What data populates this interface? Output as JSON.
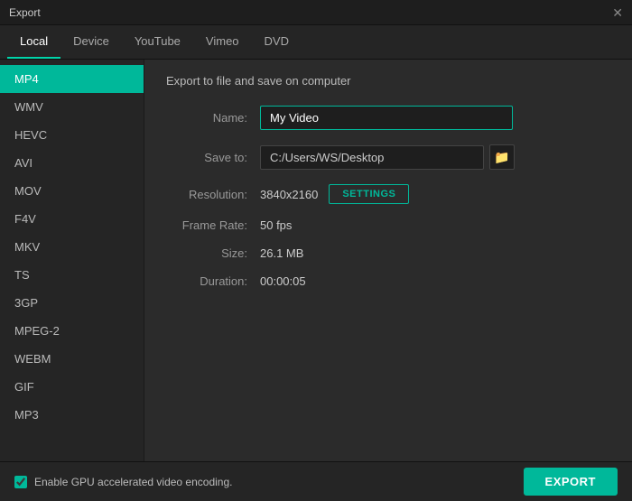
{
  "titleBar": {
    "title": "Export",
    "closeLabel": "✕"
  },
  "tabs": [
    {
      "id": "local",
      "label": "Local",
      "active": true
    },
    {
      "id": "device",
      "label": "Device",
      "active": false
    },
    {
      "id": "youtube",
      "label": "YouTube",
      "active": false
    },
    {
      "id": "vimeo",
      "label": "Vimeo",
      "active": false
    },
    {
      "id": "dvd",
      "label": "DVD",
      "active": false
    }
  ],
  "sidebar": {
    "items": [
      {
        "id": "mp4",
        "label": "MP4",
        "active": true
      },
      {
        "id": "wmv",
        "label": "WMV",
        "active": false
      },
      {
        "id": "hevc",
        "label": "HEVC",
        "active": false
      },
      {
        "id": "avi",
        "label": "AVI",
        "active": false
      },
      {
        "id": "mov",
        "label": "MOV",
        "active": false
      },
      {
        "id": "f4v",
        "label": "F4V",
        "active": false
      },
      {
        "id": "mkv",
        "label": "MKV",
        "active": false
      },
      {
        "id": "ts",
        "label": "TS",
        "active": false
      },
      {
        "id": "3gp",
        "label": "3GP",
        "active": false
      },
      {
        "id": "mpeg2",
        "label": "MPEG-2",
        "active": false
      },
      {
        "id": "webm",
        "label": "WEBM",
        "active": false
      },
      {
        "id": "gif",
        "label": "GIF",
        "active": false
      },
      {
        "id": "mp3",
        "label": "MP3",
        "active": false
      }
    ]
  },
  "content": {
    "sectionTitle": "Export to file and save on computer",
    "nameLabel": "Name:",
    "nameValue": "My Video",
    "saveToLabel": "Save to:",
    "savePath": "C:/Users/WS/Desktop",
    "resolutionLabel": "Resolution:",
    "resolutionValue": "3840x2160",
    "settingsLabel": "SETTINGS",
    "frameRateLabel": "Frame Rate:",
    "frameRateValue": "50 fps",
    "sizeLabel": "Size:",
    "sizeValue": "26.1 MB",
    "durationLabel": "Duration:",
    "durationValue": "00:00:05",
    "folderIcon": "🗁"
  },
  "footer": {
    "gpuLabel": "Enable GPU accelerated video encoding.",
    "exportLabel": "EXPORT"
  }
}
